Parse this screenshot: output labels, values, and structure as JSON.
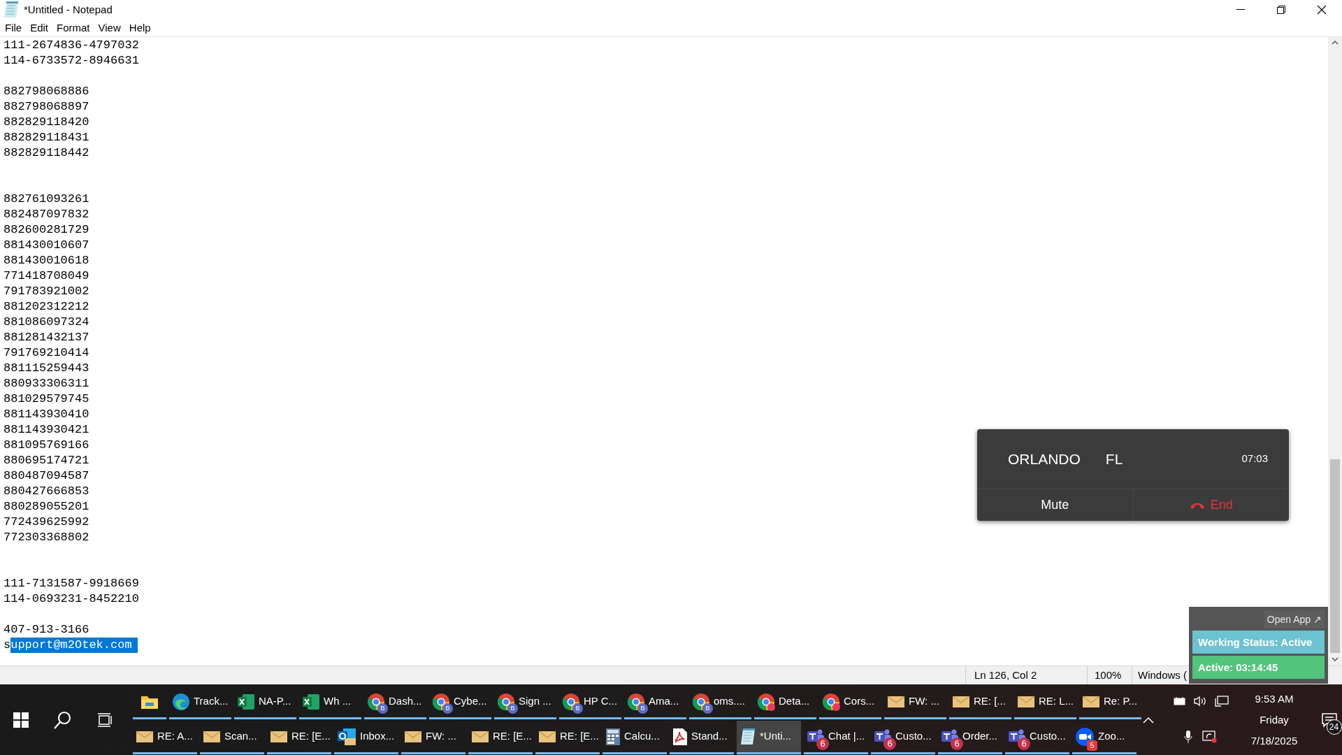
{
  "window": {
    "title": "*Untitled - Notepad"
  },
  "menu": [
    "File",
    "Edit",
    "Format",
    "View",
    "Help"
  ],
  "editor": {
    "lines": [
      {
        "kind": "text",
        "text": "111-2674836-4797032"
      },
      {
        "kind": "text",
        "text": "114-6733572-8946631"
      },
      {
        "kind": "blank"
      },
      {
        "kind": "text",
        "text": "882798068886"
      },
      {
        "kind": "text",
        "text": "882798068897"
      },
      {
        "kind": "text",
        "text": "882829118420"
      },
      {
        "kind": "text",
        "text": "882829118431"
      },
      {
        "kind": "text",
        "text": "882829118442"
      },
      {
        "kind": "blank"
      },
      {
        "kind": "blank"
      },
      {
        "kind": "text",
        "text": "882761093261"
      },
      {
        "kind": "text",
        "text": "882487097832"
      },
      {
        "kind": "text",
        "text": "882600281729"
      },
      {
        "kind": "text",
        "text": "881430010607"
      },
      {
        "kind": "text",
        "text": "881430010618"
      },
      {
        "kind": "text",
        "text": "771418708049"
      },
      {
        "kind": "text",
        "text": "791783921002"
      },
      {
        "kind": "text",
        "text": "881202312212"
      },
      {
        "kind": "text",
        "text": "881086097324"
      },
      {
        "kind": "text",
        "text": "881281432137"
      },
      {
        "kind": "text",
        "text": "791769210414"
      },
      {
        "kind": "text",
        "text": "881115259443"
      },
      {
        "kind": "text",
        "text": "880933306311"
      },
      {
        "kind": "text",
        "text": "881029579745"
      },
      {
        "kind": "text",
        "text": "881143930410"
      },
      {
        "kind": "text",
        "text": "881143930421"
      },
      {
        "kind": "text",
        "text": "881095769166"
      },
      {
        "kind": "text",
        "text": "880695174721"
      },
      {
        "kind": "text",
        "text": "880487094587"
      },
      {
        "kind": "text",
        "text": "880427666853"
      },
      {
        "kind": "text",
        "text": "880289055201"
      },
      {
        "kind": "text",
        "text": "772439625992"
      },
      {
        "kind": "text",
        "text": "772303368802"
      },
      {
        "kind": "blank"
      },
      {
        "kind": "blank"
      },
      {
        "kind": "text",
        "text": "111-7131587-9918669"
      },
      {
        "kind": "text",
        "text": "114-0693231-8452210"
      },
      {
        "kind": "blank"
      },
      {
        "kind": "text",
        "text": "407-913-3166"
      },
      {
        "kind": "text",
        "text": "s",
        "selected_text": "upport@m2Otek.com"
      }
    ]
  },
  "status_bar": {
    "position": "Ln 126, Col 2",
    "zoom": "100%",
    "line_ending": "Windows ("
  },
  "call_widget": {
    "city": "ORLANDO",
    "state": "FL",
    "timer": "07:03",
    "buttons": [
      {
        "kind": "mute",
        "label": "Mute"
      },
      {
        "kind": "end",
        "label": "End"
      }
    ]
  },
  "status_widget": {
    "open_app": "Open App ↗",
    "working_status": "Working Status: Active",
    "active_time": "Active: 03:14:45"
  },
  "taskbar": {
    "upper_row": [
      {
        "kind": "explorer",
        "selected": false
      },
      {
        "kind": "edge",
        "label": "Track...",
        "selected": false
      },
      {
        "kind": "excel",
        "label": "NA-P...",
        "selected": false
      },
      {
        "kind": "excel",
        "label": "Wh ...",
        "selected": false
      },
      {
        "kind": "chrome",
        "badge": "B",
        "label": "Dash...",
        "selected": false
      },
      {
        "kind": "chrome",
        "badge": "B",
        "label": "Cybe...",
        "selected": false
      },
      {
        "kind": "chrome",
        "badge": "B",
        "label": "Sign ...",
        "selected": false
      },
      {
        "kind": "chrome",
        "badge": "B",
        "label": "HP C...",
        "selected": false
      },
      {
        "kind": "chrome",
        "badge": "B",
        "label": "Ama...",
        "selected": false
      },
      {
        "kind": "chrome",
        "badge": "B",
        "label": "oms....",
        "selected": false
      },
      {
        "kind": "chrome_red",
        "label": "Deta...",
        "selected": false
      },
      {
        "kind": "chrome_red",
        "label": "Cors...",
        "selected": false
      },
      {
        "kind": "mail",
        "label": "FW: ...",
        "selected": false
      },
      {
        "kind": "mail",
        "label": "RE: [...",
        "selected": false
      },
      {
        "kind": "mail",
        "label": "RE: L...",
        "selected": false
      },
      {
        "kind": "mail",
        "label": "Re: P...",
        "selected": false
      }
    ],
    "lower_row": [
      {
        "kind": "mail",
        "label": "RE: A...",
        "selected": false
      },
      {
        "kind": "mail",
        "label": "Scan...",
        "selected": false
      },
      {
        "kind": "mail",
        "label": "RE: [E...",
        "selected": false
      },
      {
        "kind": "outlook",
        "label": "Inbox...",
        "selected": false
      },
      {
        "kind": "mail",
        "label": "FW: ...",
        "selected": false
      },
      {
        "kind": "mail",
        "label": "RE: [E...",
        "selected": false
      },
      {
        "kind": "mail",
        "label": "RE: [E...",
        "selected": false
      },
      {
        "kind": "calculator",
        "label": "Calcu...",
        "selected": false
      },
      {
        "kind": "pdf",
        "label": "Stand...",
        "selected": false
      },
      {
        "kind": "notepad",
        "label": "*Unti...",
        "selected": true
      },
      {
        "kind": "teams",
        "badge": "6",
        "label": "Chat |...",
        "selected": false
      },
      {
        "kind": "teams",
        "badge": "6",
        "label": "Custo...",
        "selected": false
      },
      {
        "kind": "teams",
        "badge": "6",
        "label": "Order...",
        "selected": false
      },
      {
        "kind": "teams",
        "badge": "6",
        "label": "Custo...",
        "selected": false
      },
      {
        "kind": "zoom",
        "badge": "5",
        "label": "Zoo...",
        "selected": false
      }
    ],
    "clock": {
      "time": "9:53 AM",
      "day": "Friday",
      "date": "7/18/2025"
    },
    "notifications": "24"
  }
}
